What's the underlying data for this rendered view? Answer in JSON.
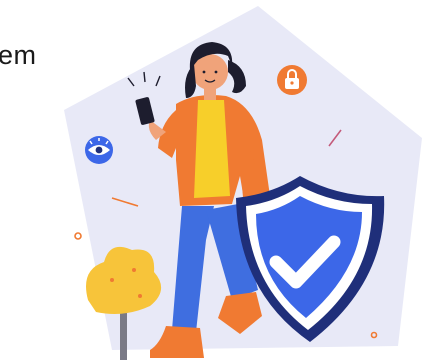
{
  "caption": {
    "text": "em"
  },
  "illustration": {
    "subject": "person-with-phone-and-security-shield",
    "icons": [
      "lock-icon",
      "eye-icon",
      "check-icon"
    ],
    "colors": {
      "background_shape": "#e8e9f7",
      "shield_outer": "#1f2f7a",
      "shield_inner": "#3c67e8",
      "shield_white": "#ffffff",
      "jacket": "#f07a32",
      "shirt": "#f7cf2a",
      "pants": "#3f6ee0",
      "hair": "#1d1d2e",
      "plant": "#f7c43a",
      "badge_orange": "#f07a32",
      "badge_blue": "#3c67e8"
    }
  }
}
